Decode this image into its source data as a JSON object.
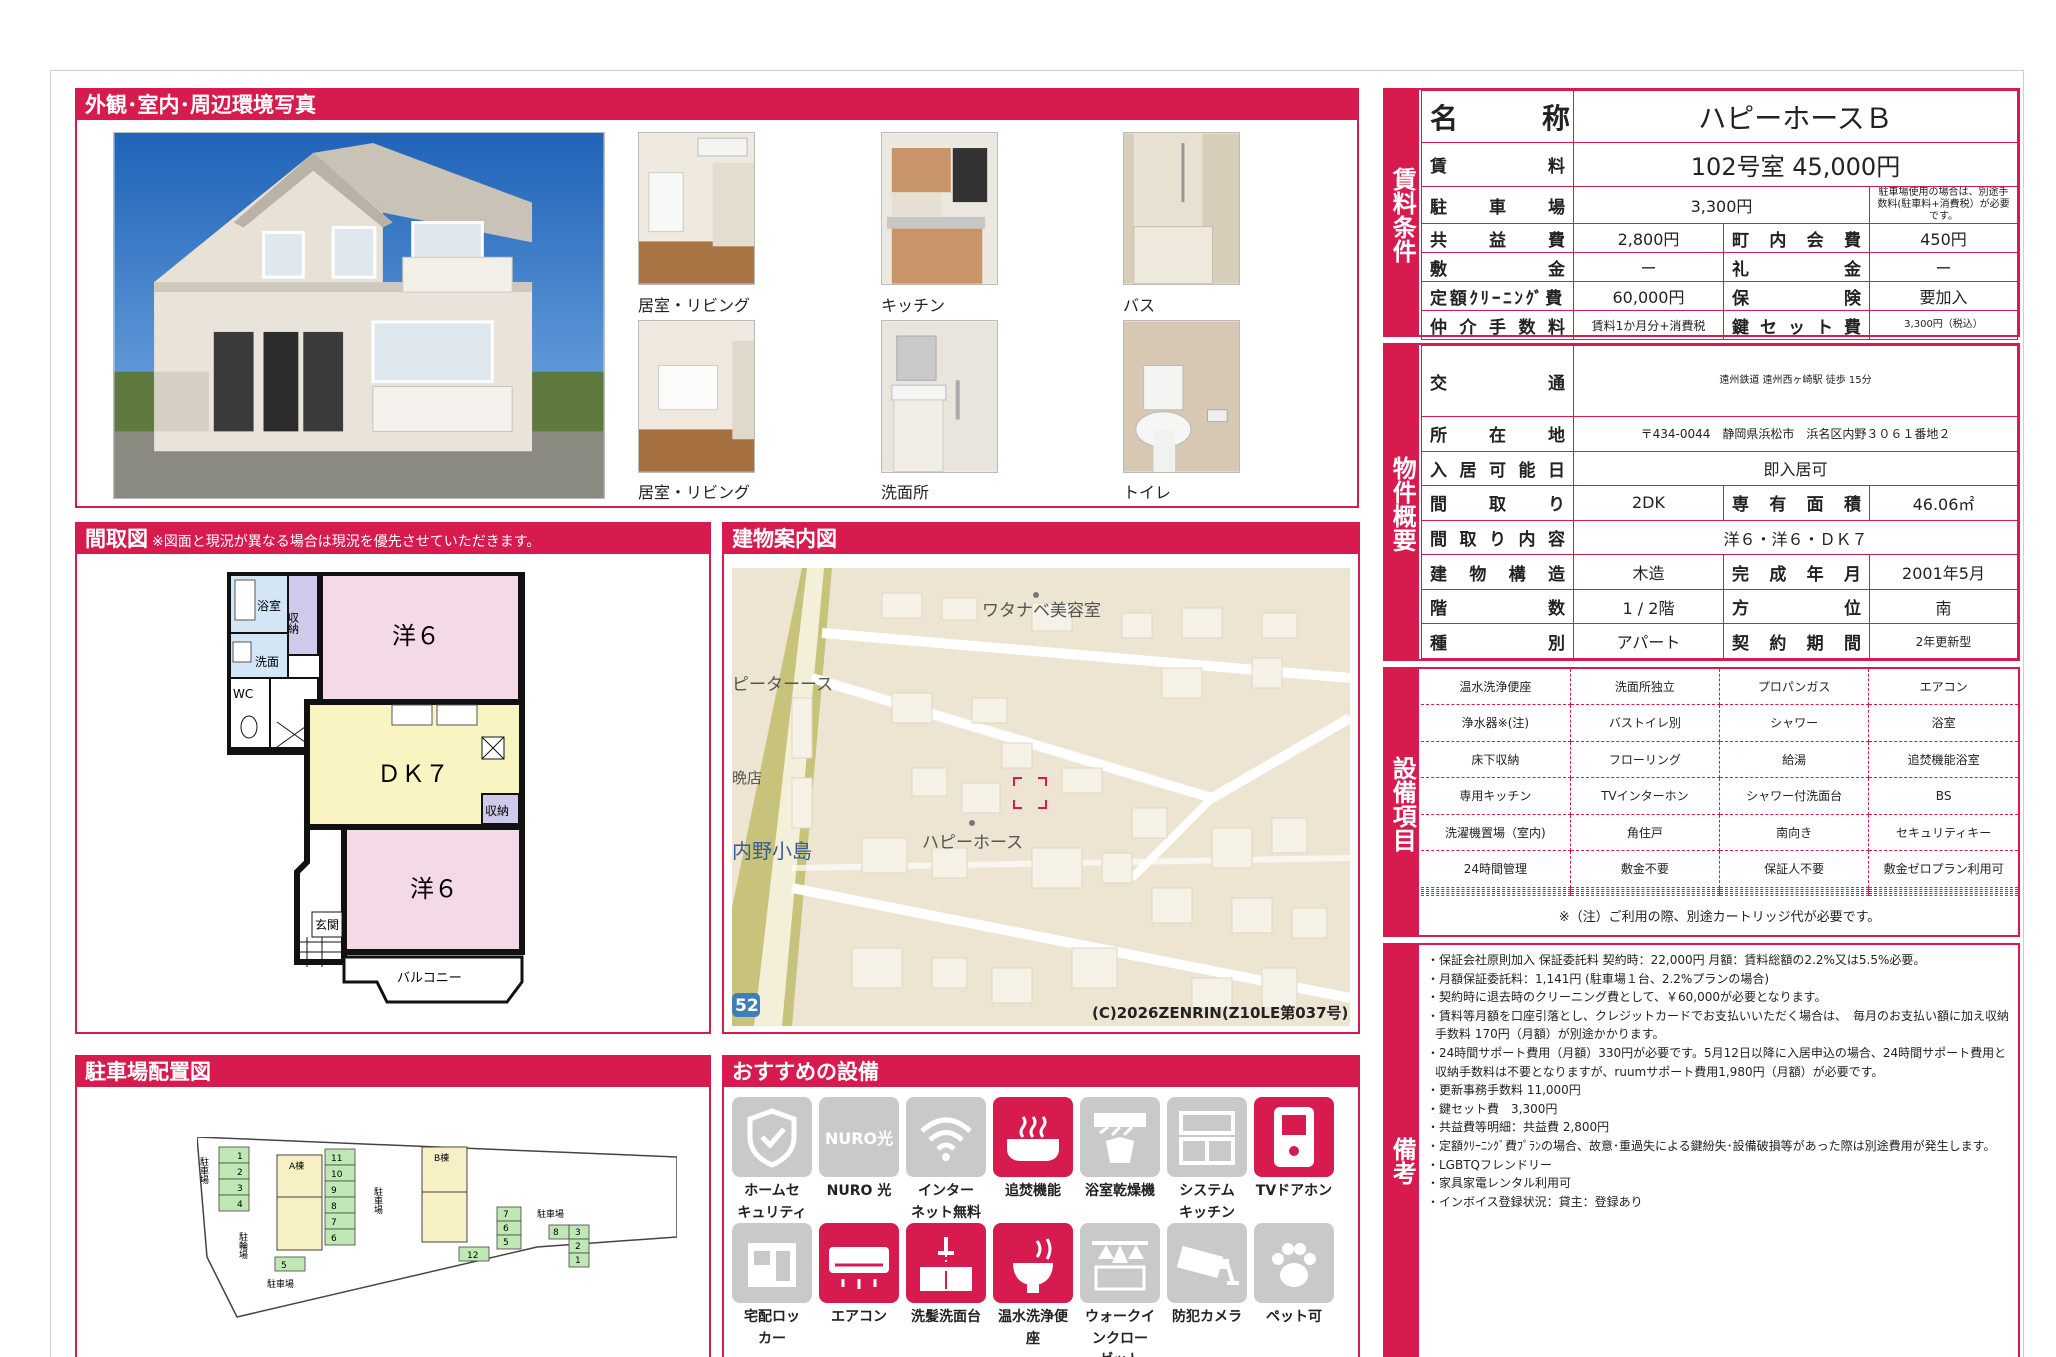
{
  "photos_panel": {
    "title": "外観･室内･周辺環境写真",
    "captions": [
      "居室・リビング",
      "キッチン",
      "バス",
      "居室・リビング",
      "洗面所",
      "トイレ"
    ]
  },
  "floorplan": {
    "title": "間取図",
    "note": "※図面と現況が異なる場合は現況を優先させていただきます。",
    "rooms": {
      "bath": "浴室",
      "storage1": "収納",
      "wash": "洗面",
      "wc": "WC",
      "room1": "洋６",
      "dk": "ＤＫ７",
      "storage2": "収納",
      "room2": "洋６",
      "entrance": "玄関",
      "balcony": "バルコニー"
    }
  },
  "map": {
    "title": "建物案内図",
    "labels": {
      "salon": "ワタナベ美容室",
      "store": "ピーターース",
      "shop": "晩店",
      "area": "内野小島",
      "building": "ハピーホース",
      "route": "52"
    },
    "copyright": "(C)2026ZENRIN(Z10LE第037号)"
  },
  "parking": {
    "title": "駐車場配置図",
    "labels": {
      "lot": "駐車場",
      "bike": "駐輪場",
      "a": "A棟",
      "b": "B棟",
      "lot2": "駐車場"
    },
    "left_nums": [
      "1",
      "2",
      "3",
      "4"
    ],
    "mid_nums": [
      "11",
      "10",
      "9",
      "8",
      "7",
      "6"
    ],
    "right_nums": [
      "7",
      "6",
      "5"
    ],
    "far_nums": [
      "3",
      "2",
      "1"
    ],
    "misc_nums": [
      "5",
      "12",
      "8"
    ]
  },
  "features": {
    "title": "おすすめの設備",
    "items": [
      {
        "label": "ホームセ\nキュリティ",
        "on": false,
        "icon": "shield-icon"
      },
      {
        "label": "NURO 光",
        "on": false,
        "icon": "nuro-icon"
      },
      {
        "label": "インター\nネット無料",
        "on": false,
        "icon": "wifi-icon"
      },
      {
        "label": "追焚機能",
        "on": true,
        "icon": "bathtub-icon"
      },
      {
        "label": "浴室乾燥機",
        "on": false,
        "icon": "bath-dryer-icon"
      },
      {
        "label": "システム\nキッチン",
        "on": false,
        "icon": "kitchen-icon"
      },
      {
        "label": "TVドアホン",
        "on": true,
        "icon": "intercom-icon"
      },
      {
        "label": "宅配ロッ\nカー",
        "on": false,
        "icon": "locker-icon"
      },
      {
        "label": "エアコン",
        "on": true,
        "icon": "aircon-icon"
      },
      {
        "label": "洗髪洗面台",
        "on": true,
        "icon": "sink-icon"
      },
      {
        "label": "温水洗浄便\n座",
        "on": true,
        "icon": "toilet-icon"
      },
      {
        "label": "ウォークイ\nンクロー\nゼット",
        "on": false,
        "icon": "closet-icon"
      },
      {
        "label": "防犯カメラ",
        "on": false,
        "icon": "camera-icon"
      },
      {
        "label": "ペット可",
        "on": false,
        "icon": "paw-icon"
      }
    ]
  },
  "rent": {
    "side_label": "賃料条件",
    "name_label": "名　　　称",
    "name": "ハピーホースＢ",
    "rent_label": "賃　　　　　料",
    "rent": "102号室 45,000円",
    "parking_label": "駐　車　場",
    "parking": "3,300円",
    "parking_note": "駐車場使用の場合は、別途手数料(駐車料+消費税）が必要です。",
    "common_label": "共　益　費",
    "common": "2,800円",
    "town_label": "町　内　会　費",
    "town": "450円",
    "deposit_label": "敷　　　　金",
    "deposit": "ー",
    "key_money_label": "礼　　　　金",
    "key_money": "ー",
    "cleaning_label": "定額ｸﾘｰﾆﾝｸﾞ費",
    "cleaning": "60,000円",
    "insurance_label": "保　　　険",
    "insurance": "要加入",
    "brokerage_label": "仲介手数料",
    "brokerage": "賃料1か月分+消費税",
    "key_set_label": "鍵セット費",
    "key_set": "3,300円（税込）"
  },
  "property": {
    "side_label": "物件概要",
    "transport_label": "交　　　　通",
    "transport": "遠州鉄道 遠州西ヶ崎駅 徒歩 15分",
    "address_label": "所　在　地",
    "address": "〒434-0044　静岡県浜松市　浜名区内野３０６１番地２",
    "move_in_label": "入居可能日",
    "move_in": "即入居可",
    "layout_label": "間　　取　　り",
    "layout": "2DK",
    "area_label": "専有面積",
    "area": "46.06㎡",
    "detail_label": "間取り内容",
    "detail": "洋６・洋６・ＤＫ７",
    "structure_label": "建物構造",
    "structure": "木造",
    "built_label": "完成年月",
    "built": "2001年5月",
    "floor_label": "階　　　　数",
    "floor": "1 / 2階",
    "direction_label": "方　　　位",
    "direction": "南",
    "type_label": "種　　　　別",
    "type": "アパート",
    "contract_label": "契約期間",
    "contract": "2年更新型"
  },
  "equipment": {
    "side_label": "設備項目",
    "rows": [
      [
        "温水洗浄便座",
        "洗面所独立",
        "プロパンガス",
        "エアコン"
      ],
      [
        "浄水器※(注)",
        "バストイレ別",
        "シャワー",
        "浴室"
      ],
      [
        "床下収納",
        "フローリング",
        "給湯",
        "追焚機能浴室"
      ],
      [
        "専用キッチン",
        "TVインターホン",
        "シャワー付洗面台",
        "BS"
      ],
      [
        "洗濯機置場（室内)",
        "角住戸",
        "南向き",
        "セキュリティキー"
      ],
      [
        "24時間管理",
        "敷金不要",
        "保証人不要",
        "敷金ゼロプラン利用可"
      ],
      [
        "",
        "",
        "",
        ""
      ],
      [
        "",
        "",
        "",
        ""
      ],
      [
        "",
        "",
        "",
        ""
      ],
      [
        "",
        "",
        "",
        ""
      ]
    ],
    "footnote": "※（注）ご利用の際、別途カートリッジ代が必要です。"
  },
  "remarks": {
    "side_label": "備考",
    "lines": [
      "・保証会社原則加入 保証委託料 契約時：22,000円 月額：賃料総額の2.2%又は5.5%必要。",
      "・月額保証委託料：1,141円 (駐車場１台、2.2%プランの場合)",
      "・契約時に退去時のクリーニング費として、￥60,000が必要となります。",
      "・賃料等月額を口座引落とし、クレジットカードでお支払いいただく場合は、　毎月のお支払い額に加え収納手数料 170円（月額）が別途かかります。",
      "・24時間サポート費用（月額）330円が必要です。5月12日以降に入居申込の場合、24時間サポート費用と収納手数料は不要となりますが、ruumサポート費用1,980円（月額）が必要です。",
      "・更新事務手数料 11,000円",
      "・鍵セット費　3,300円",
      "・共益費等明細：共益費 2,800円",
      "・定額ｸﾘｰﾆﾝｸﾞ費ﾌﾟﾗﾝの場合、故意･重過失による鍵紛失･設備破損等があった際は別途費用が発生します。",
      "・LGBTQフレンドリー",
      "・家具家電レンタル利用可",
      "・インボイス登録状況：貸主：登録あり"
    ]
  },
  "colors": {
    "accent": "#d81b4f",
    "tile_off": "#c9c9c9"
  }
}
